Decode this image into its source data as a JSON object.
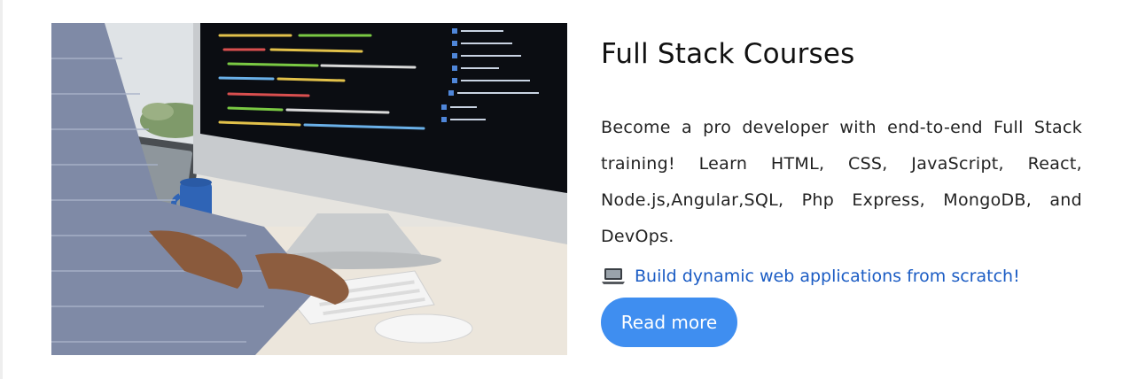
{
  "card": {
    "title": "Full Stack Courses",
    "description": "Become a pro developer with end-to-end Full Stack training! Learn HTML, CSS, JavaScript, React, Node.js,Angular,SQL, Php Express, MongoDB, and DevOps.",
    "highlight_icon": "laptop-icon",
    "highlight_text": "Build dynamic web applications from scratch!",
    "button_label": "Read more",
    "image_alt": "Developer typing code on a desktop computer"
  },
  "colors": {
    "accent_button": "#3f8ef0",
    "link_text": "#1b5cc4",
    "title_text": "#111111"
  }
}
